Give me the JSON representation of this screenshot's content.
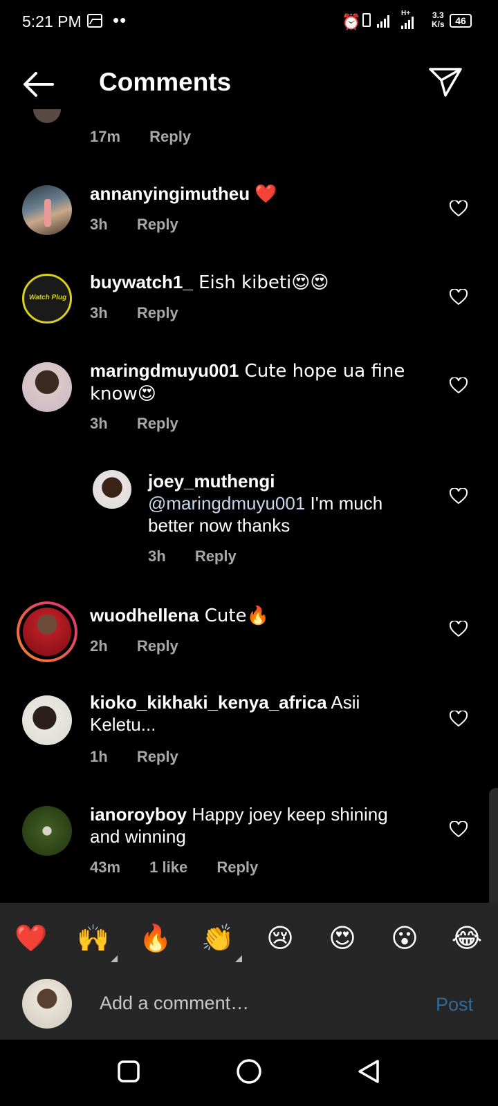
{
  "status_bar": {
    "time": "5:21 PM",
    "dots": "••",
    "network_type": "H+",
    "speed_value": "3.3",
    "speed_unit": "K/s",
    "battery": "46"
  },
  "header": {
    "title": "Comments",
    "back_icon": "arrow-left-icon",
    "share_icon": "paper-plane-icon"
  },
  "comments": [
    {
      "time": "17m",
      "reply": "Reply"
    },
    {
      "username": "annanyingimutheu",
      "text": "❤️",
      "time": "3h",
      "reply": "Reply"
    },
    {
      "username": "buywatch1_",
      "text": " Eish kibeti😍😍",
      "time": "3h",
      "reply": "Reply",
      "avatar_text": "Watch Plug"
    },
    {
      "username": "maringdmuyu001",
      "text": " Cute  hope ua fine know😍",
      "time": "3h",
      "reply": "Reply"
    },
    {
      "username": "joey_muthengi",
      "mention": "@maringdmuyu001",
      "text": " I'm much better now thanks",
      "time": "3h",
      "reply": "Reply"
    },
    {
      "username": "wuodhellena",
      "text": " Cute🔥",
      "time": "2h",
      "reply": "Reply"
    },
    {
      "username": "kioko_kikhaki_kenya_africa",
      "text": " Asii Keletu...",
      "time": "1h",
      "reply": "Reply"
    },
    {
      "username": "ianoroyboy",
      "text": " Happy joey keep shining and winning",
      "time": "43m",
      "likes": "1 like",
      "reply": "Reply"
    }
  ],
  "reactions": [
    "❤️",
    "🙌",
    "🔥",
    "👏",
    "😢",
    "😍",
    "😮",
    "😂"
  ],
  "comment_input": {
    "placeholder": "Add a comment…",
    "post_label": "Post"
  },
  "nav_bar": {
    "recents_icon": "square-icon",
    "home_icon": "circle-icon",
    "back_icon": "triangle-back-icon"
  },
  "colors": {
    "background": "#000000",
    "secondary_text": "#a8a8a8",
    "heart_red": "#e0202c",
    "post_blue": "#2f6a99",
    "input_bg": "#262626",
    "story_ring_start": "#f58529",
    "story_ring_end": "#dd2a7b"
  }
}
